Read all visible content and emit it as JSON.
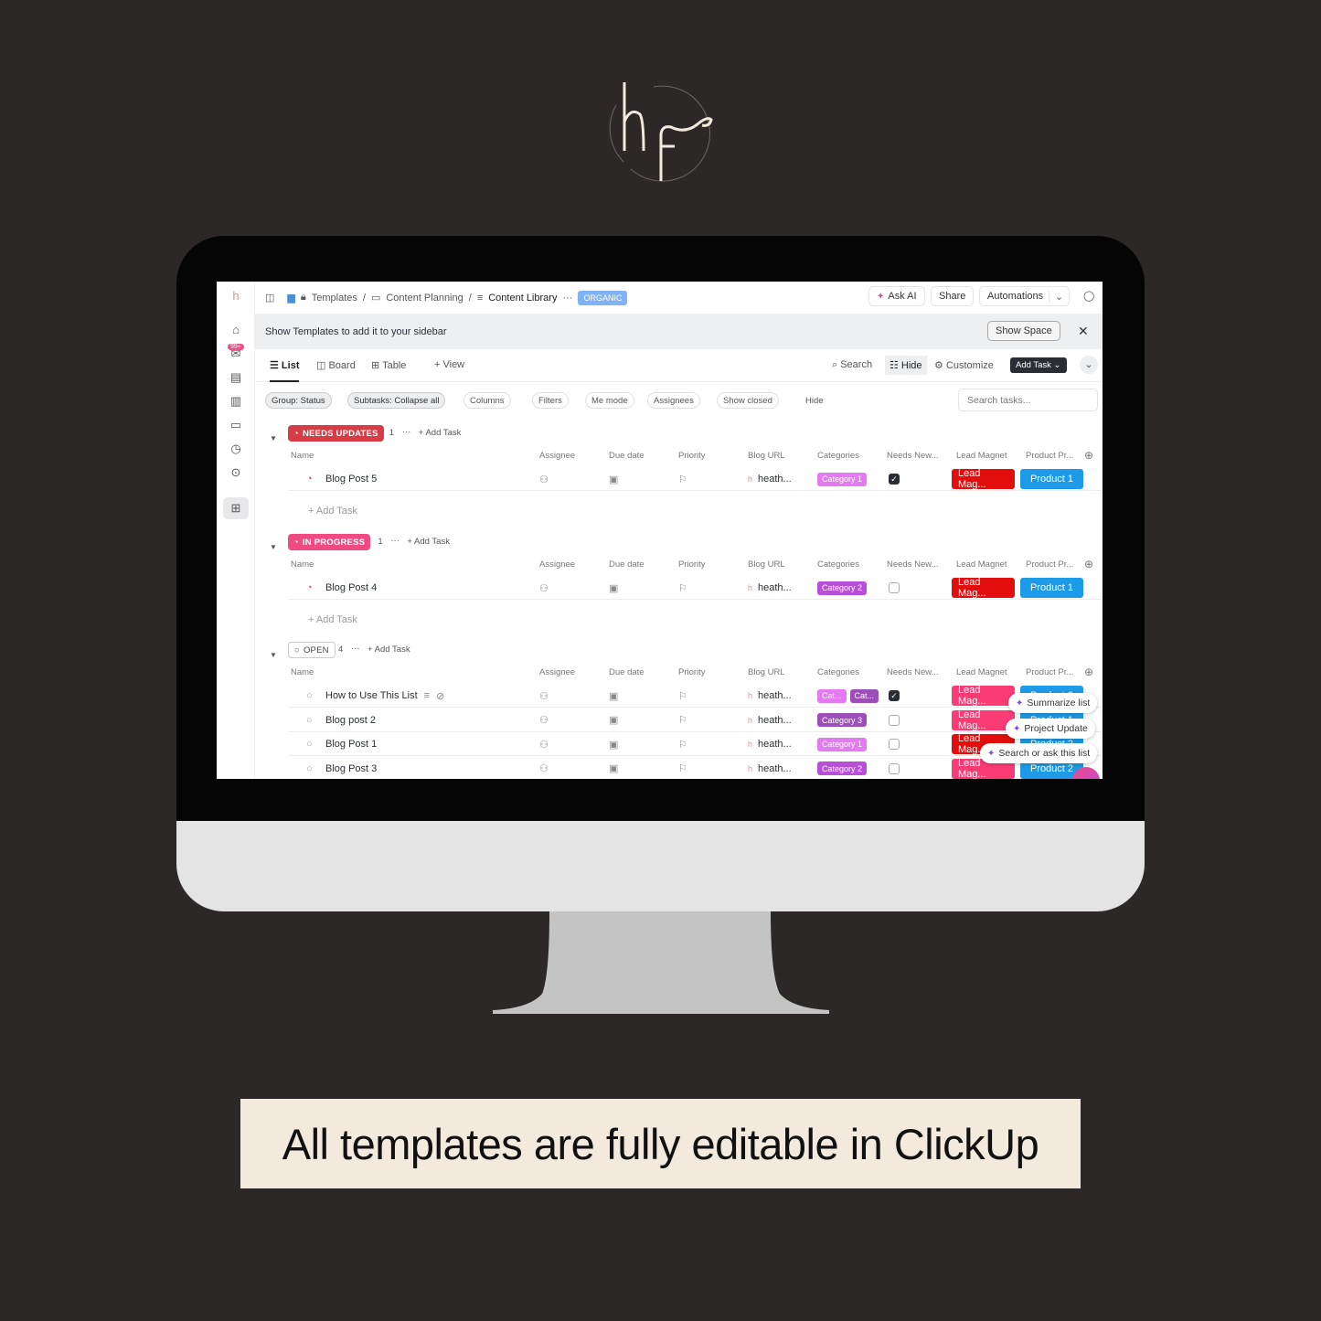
{
  "brand": {
    "logo_text": "hf"
  },
  "banner": {
    "text": "All templates are fully editable in ClickUp"
  },
  "topbar": {
    "breadcrumb": [
      "Templates",
      "Content Planning",
      "Content Library"
    ],
    "more": "···",
    "badge": "ORGANIC",
    "ask_ai": "Ask AI",
    "share": "Share",
    "automations": "Automations"
  },
  "sidebar": {
    "inbox_badge": "99+"
  },
  "notice": {
    "text": "Show Templates to add it to your sidebar",
    "button": "Show Space"
  },
  "views": {
    "tabs": [
      "List",
      "Board",
      "Table"
    ],
    "add_view": "View",
    "search": "Search",
    "hide": "Hide",
    "customize": "Customize",
    "add_task": "Add Task"
  },
  "filters": {
    "chips": [
      "Group: Status",
      "Subtasks: Collapse all",
      "Columns",
      "Filters",
      "Me mode",
      "Assignees",
      "Show closed",
      "Hide"
    ],
    "search_placeholder": "Search tasks..."
  },
  "columns": [
    "Name",
    "Assignee",
    "Due date",
    "Priority",
    "Blog URL",
    "Categories",
    "Needs New...",
    "Lead Magnet",
    "Product Pr..."
  ],
  "add_task_label": "Add Task",
  "colors": {
    "needs_updates": "#d63c45",
    "in_progress": "#ef4a82",
    "lead_red": "#e20e0e",
    "lead_pink": "#fb3b74",
    "product_blue": "#1d9be8",
    "cat1": "#e47af2",
    "cat2": "#b84fd8",
    "cat3": "#9d4fb9"
  },
  "groups": [
    {
      "status": "NEEDS UPDATES",
      "color": "#d63c45",
      "count": "1",
      "tasks": [
        {
          "name": "Blog Post 5",
          "url": "heath...",
          "categories": [
            {
              "label": "Category 1",
              "color": "#e47af2"
            }
          ],
          "checked": true,
          "lead": "Lead Mag...",
          "lead_color": "#e20e0e",
          "product": "Product 1"
        }
      ]
    },
    {
      "status": "IN PROGRESS",
      "color": "#ef4a82",
      "count": "1",
      "tasks": [
        {
          "name": "Blog Post 4",
          "url": "heath...",
          "categories": [
            {
              "label": "Category 2",
              "color": "#b84fd8"
            }
          ],
          "checked": false,
          "lead": "Lead Mag...",
          "lead_color": "#e20e0e",
          "product": "Product 1"
        }
      ]
    },
    {
      "status": "OPEN",
      "color": "",
      "count": "4",
      "tasks": [
        {
          "name": "How to Use This List",
          "url": "heath...",
          "categories": [
            {
              "label": "Cat...",
              "color": "#e47af2"
            },
            {
              "label": "Cat...",
              "color": "#9d4fb9"
            }
          ],
          "checked": true,
          "lead": "Lead Mag...",
          "lead_color": "#fb3b74",
          "product": "Product 3"
        },
        {
          "name": "Blog post 2",
          "url": "heath...",
          "categories": [
            {
              "label": "Category 3",
              "color": "#9d4fb9"
            }
          ],
          "checked": false,
          "lead": "Lead Mag...",
          "lead_color": "#fb3b74",
          "product": "Product 1"
        },
        {
          "name": "Blog Post 1",
          "url": "heath...",
          "categories": [
            {
              "label": "Category 1",
              "color": "#e47af2"
            }
          ],
          "checked": false,
          "lead": "Lead Mag...",
          "lead_color": "#e20e0e",
          "product": "Product 2"
        },
        {
          "name": "Blog Post 3",
          "url": "heath...",
          "categories": [
            {
              "label": "Category 2",
              "color": "#b84fd8"
            }
          ],
          "checked": false,
          "lead": "Lead Mag...",
          "lead_color": "#fb3b74",
          "product": "Product 2"
        }
      ]
    }
  ],
  "ai_menu": [
    "Summarize list",
    "Project Update",
    "Search or ask this list"
  ]
}
